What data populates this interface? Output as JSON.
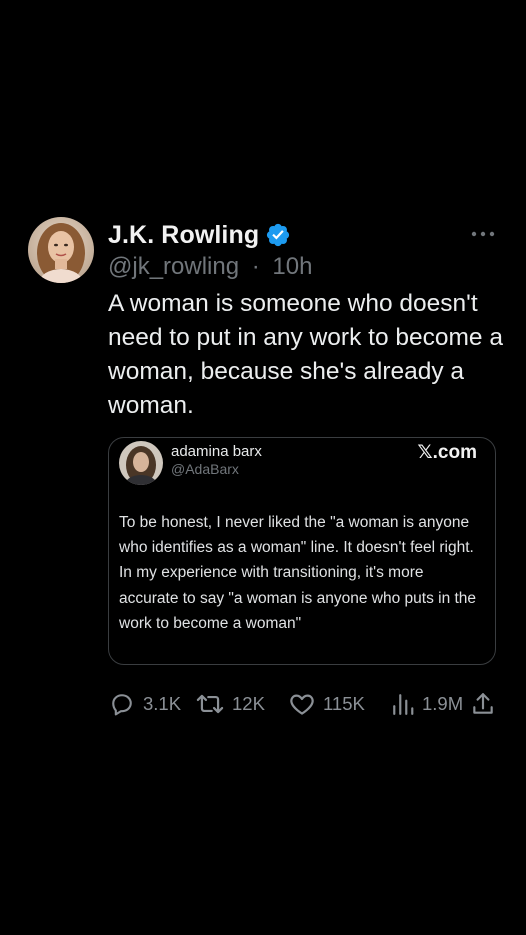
{
  "author": {
    "display_name": "J.K. Rowling",
    "handle": "@jk_rowling",
    "separator": "·",
    "time": "10h",
    "verified": true
  },
  "tweet": {
    "text": "A woman is someone who doesn't need to put in any work to become a woman, because she's already a woman."
  },
  "quoted": {
    "display_name": "adamina barx",
    "handle": "@AdaBarx",
    "site": "𝕏.com",
    "text": "To be honest, I never liked the \"a woman is anyone who identifies as a woman\" line. It doesn't feel right. In my experience with transitioning, it's more accurate to say \"a woman is anyone who puts in the work to become a woman\""
  },
  "actions": {
    "replies": "3.1K",
    "retweets": "12K",
    "likes": "115K",
    "views": "1.9M"
  },
  "icons": {
    "verified": "verified-badge-icon",
    "more": "more-icon",
    "reply": "reply-icon",
    "retweet": "retweet-icon",
    "like": "heart-icon",
    "views": "views-chart-icon",
    "share": "share-icon"
  },
  "colors": {
    "background": "#000000",
    "verified_blue": "#1d9bf0",
    "secondary_text": "#71767b"
  }
}
